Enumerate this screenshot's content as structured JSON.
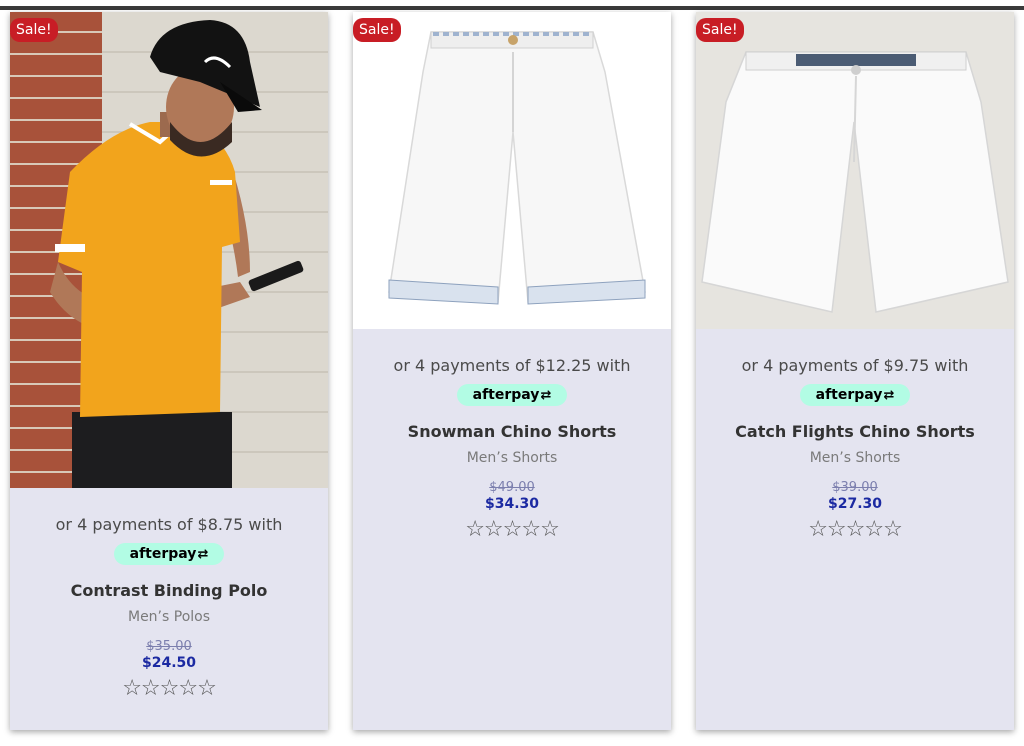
{
  "products": [
    {
      "sale_badge": "Sale!",
      "payments": "or 4 payments of $8.75 with",
      "afterpay_label": "afterpay",
      "title": "Contrast Binding Polo",
      "category": "Men’s Polos",
      "old_price": "$35.00",
      "new_price": "$24.50",
      "rating_stars": 0,
      "stars_text": "☆☆☆☆☆"
    },
    {
      "sale_badge": "Sale!",
      "payments": "or 4 payments of $12.25 with",
      "afterpay_label": "afterpay",
      "title": "Snowman Chino Shorts",
      "category": "Men’s Shorts",
      "old_price": "$49.00",
      "new_price": "$34.30",
      "rating_stars": 0,
      "stars_text": "☆☆☆☆☆"
    },
    {
      "sale_badge": "Sale!",
      "payments": "or 4 payments of $9.75 with",
      "afterpay_label": "afterpay",
      "title": "Catch Flights Chino Shorts",
      "category": "Men’s Shorts",
      "old_price": "$39.00",
      "new_price": "$27.30",
      "rating_stars": 0,
      "stars_text": "☆☆☆☆☆"
    }
  ],
  "colors": {
    "card_background": "#e4e4f0",
    "sale_badge": "#c81d25",
    "afterpay_pill": "#b2fce4",
    "sale_price": "#1c2aa2"
  }
}
